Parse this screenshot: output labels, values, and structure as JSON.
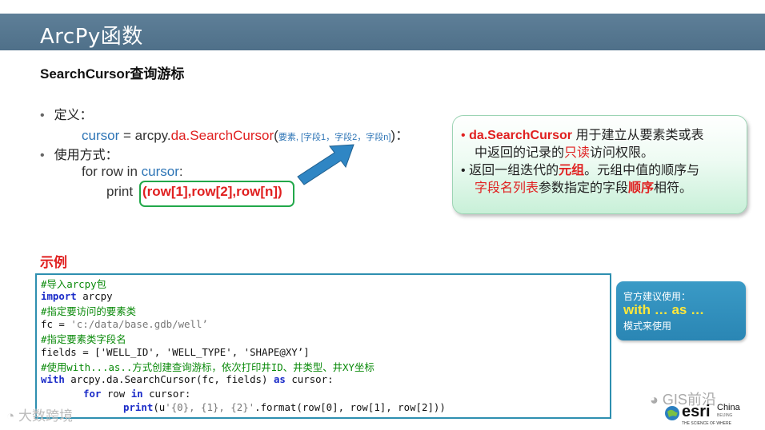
{
  "header": {
    "title": "ArcPy函数"
  },
  "subtitle": "SearchCursor查询游标",
  "definition": {
    "bullet": "定义：",
    "cursor_var": "cursor",
    "assign": " = arcpy.",
    "func": "da.SearchCursor",
    "paren_open": "(",
    "params": "要素, [字段1，字段2，字段n]",
    "paren_close": ")",
    "tail": "："
  },
  "usage": {
    "bullet": "使用方式：",
    "for_text": "for row in ",
    "for_cursor": "cursor",
    "for_colon": ":",
    "print_text": "print",
    "print_args": "(row[1],row[2],row[n])"
  },
  "callout": {
    "line1_bold": "da.SearchCursor",
    "line1_rest": " 用于建立从要素类或表",
    "line2_a": "中返回的记录的",
    "line2_red": "只读",
    "line2_b": "访问权限。",
    "line3_a": "返回一组迭代的",
    "line3_red": "元组",
    "line3_b": "。元组中值的顺序与",
    "line4_red1": "字段名列表",
    "line4_a": "参数指定的字段",
    "line4_red2": "顺序",
    "line4_b": "相符。"
  },
  "example_label": "示例",
  "code": {
    "l1": "#导入arcpy包",
    "l2_kw": "import",
    "l2_rest": " arcpy",
    "l3": "#指定要访问的要素类",
    "l4_a": "fc = ",
    "l4_str": "'c:/data/base.gdb/well’",
    "l5": "#指定要素类字段名",
    "l6": "fields = ['WELL_ID', 'WELL_TYPE', 'SHAPE@XY’]",
    "l7": "#使用with...as..方式创建查询游标，依次打印井ID、井类型、井XY坐标",
    "l8_kw1": "with",
    "l8_mid": " arcpy.da.SearchCursor(fc, fields) ",
    "l8_kw2": "as",
    "l8_end": " cursor:",
    "l9_kw1": "for",
    "l9_mid": " row ",
    "l9_kw2": "in",
    "l9_end": " cursor:",
    "l10_kw": "print",
    "l10_a": "(u",
    "l10_str": "'{0}, {1}, {2}'",
    "l10_end": ".format(row[0], row[1], row[2]))"
  },
  "side_box": {
    "line1": "官方建议使用：",
    "line2": "with  … as …",
    "line3": "模式来使用"
  },
  "watermarks": {
    "left": "大数跨境",
    "right": "GIS前沿"
  },
  "logo": {
    "word": "esri",
    "country": "China",
    "city": "BEIJING",
    "tagline": "THE SCIENCE OF WHERE"
  },
  "colors": {
    "header_bg": "#5a7b94",
    "accent_red": "#e02020",
    "accent_blue": "#2e75b6",
    "code_border": "#2e8fb0",
    "highlight_green": "#22a84a"
  }
}
